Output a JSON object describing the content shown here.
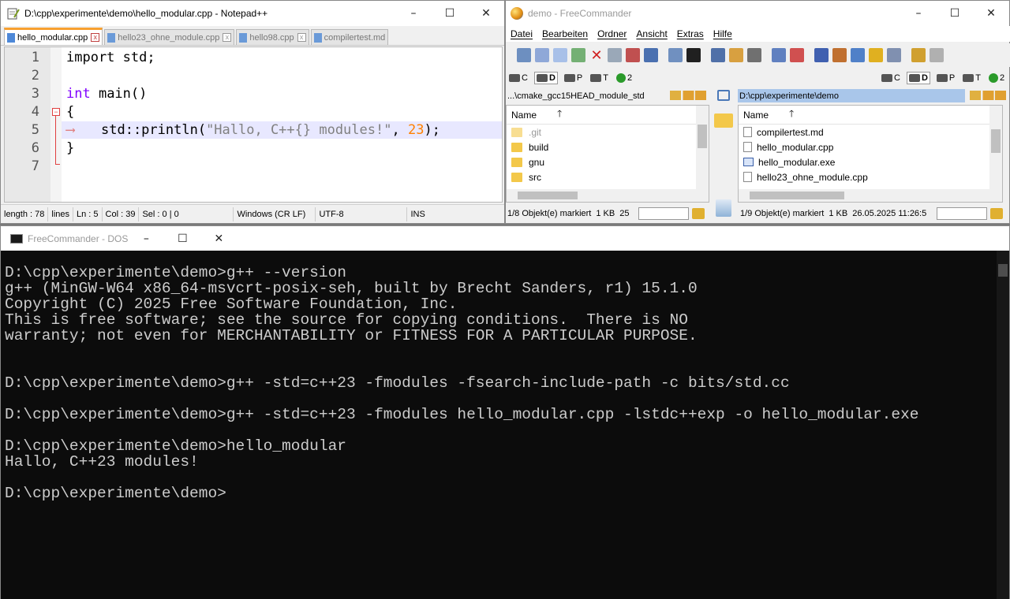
{
  "npp": {
    "title": "D:\\cpp\\experimente\\demo\\hello_modular.cpp - Notepad++",
    "tabs": [
      "hello_modular.cpp",
      "hello23_ohne_module.cpp",
      "hello98.cpp",
      "compilertest.md"
    ],
    "line_numbers": [
      "1",
      "2",
      "3",
      "4",
      "5",
      "6",
      "7"
    ],
    "code": {
      "l1": "import std;",
      "l3_kw": "int",
      "l3_rest": " main()",
      "l4": "{",
      "l5_fn": "std::println(",
      "l5_str": "\"Hallo, C++{} modules!\"",
      "l5_sep": ", ",
      "l5_num": "23",
      "l5_end": ");",
      "l6": "}"
    },
    "status": {
      "length": "length : 78",
      "lines": "lines",
      "ln": "Ln : 5",
      "col": "Col : 39",
      "sel": "Sel : 0 | 0",
      "eol": "Windows (CR LF)",
      "enc": "UTF-8",
      "mode": "INS"
    }
  },
  "fc": {
    "title": "demo - FreeCommander",
    "menu": [
      "Datei",
      "Bearbeiten",
      "Ordner",
      "Ansicht",
      "Extras",
      "Hilfe"
    ],
    "drives": [
      "C",
      "D",
      "P",
      "T",
      "2"
    ],
    "left": {
      "path": "...\\cmake_gcc15HEAD_module_std",
      "header": "Name",
      "items": [
        ".git",
        "build",
        "gnu",
        "src"
      ],
      "status": "1/8 Objekt(e) markiert",
      "size": "1 KB",
      "extra": "25"
    },
    "right": {
      "path": "D:\\cpp\\experimente\\demo",
      "header": "Name",
      "items": [
        "compilertest.md",
        "hello_modular.cpp",
        "hello_modular.exe",
        "hello23_ohne_module.cpp"
      ],
      "status": "1/9 Objekt(e) markiert",
      "size": "1 KB",
      "date": "26.05.2025 11:26:5"
    }
  },
  "dos": {
    "title": "FreeCommander - DOS",
    "lines": [
      "D:\\cpp\\experimente\\demo>g++ --version",
      "g++ (MinGW-W64 x86_64-msvcrt-posix-seh, built by Brecht Sanders, r1) 15.1.0",
      "Copyright (C) 2025 Free Software Foundation, Inc.",
      "This is free software; see the source for copying conditions.  There is NO",
      "warranty; not even for MERCHANTABILITY or FITNESS FOR A PARTICULAR PURPOSE.",
      "",
      "",
      "D:\\cpp\\experimente\\demo>g++ -std=c++23 -fmodules -fsearch-include-path -c bits/std.cc",
      "",
      "D:\\cpp\\experimente\\demo>g++ -std=c++23 -fmodules hello_modular.cpp -lstdc++exp -o hello_modular.exe",
      "",
      "D:\\cpp\\experimente\\demo>hello_modular",
      "Hallo, C++23 modules!",
      "",
      "D:\\cpp\\experimente\\demo>"
    ]
  },
  "colors": {
    "keyword": "#8000ff",
    "string": "#808080",
    "number": "#ff8000",
    "fold": "#e04040",
    "dos_bg": "#0c0c0c",
    "dos_fg": "#cccccc"
  }
}
